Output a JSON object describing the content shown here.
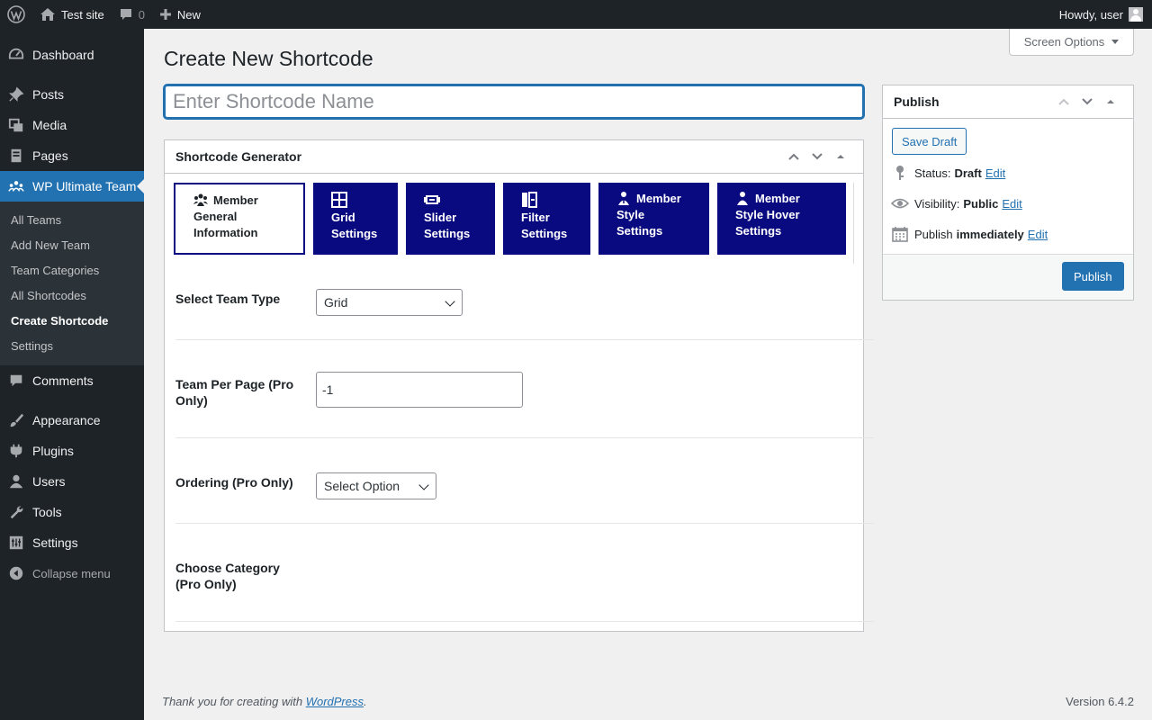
{
  "adminbar": {
    "site_name": "Test site",
    "comments_count": "0",
    "new_label": "New",
    "howdy": "Howdy, user"
  },
  "sidebar": {
    "items": [
      {
        "label": "Dashboard",
        "icon": "dashboard-icon"
      },
      {
        "label": "Posts",
        "icon": "pin-icon"
      },
      {
        "label": "Media",
        "icon": "media-icon"
      },
      {
        "label": "Pages",
        "icon": "pages-icon"
      },
      {
        "label": "WP Ultimate Team",
        "icon": "team-icon"
      },
      {
        "label": "Comments",
        "icon": "comment-icon"
      },
      {
        "label": "Appearance",
        "icon": "brush-icon"
      },
      {
        "label": "Plugins",
        "icon": "plugin-icon"
      },
      {
        "label": "Users",
        "icon": "user-icon"
      },
      {
        "label": "Tools",
        "icon": "wrench-icon"
      },
      {
        "label": "Settings",
        "icon": "settings-icon"
      }
    ],
    "submenu": [
      "All Teams",
      "Add New Team",
      "Team Categories",
      "All Shortcodes",
      "Create Shortcode",
      "Settings"
    ],
    "collapse_label": "Collapse menu"
  },
  "screen_options": "Screen Options",
  "page_title": "Create New Shortcode",
  "title_input": {
    "placeholder": "Enter Shortcode Name",
    "value": ""
  },
  "generator": {
    "title": "Shortcode Generator",
    "tabs": [
      {
        "l1": "Member",
        "l2": "General",
        "l3": "Information",
        "icon": "group-icon"
      },
      {
        "l1": "Grid",
        "l2": "Settings",
        "icon": "grid-icon"
      },
      {
        "l1": "Slider",
        "l2": "Settings",
        "icon": "slider-icon"
      },
      {
        "l1": "Filter",
        "l2": "Settings",
        "icon": "filter-icon"
      },
      {
        "l1": "Member",
        "l2": "Style",
        "l3": "Settings",
        "icon": "member-icon"
      },
      {
        "l1": "Member",
        "l2": "Style Hover",
        "l3": "Settings",
        "icon": "member-hover-icon"
      }
    ],
    "fields": {
      "team_type": {
        "label": "Select Team Type",
        "value": "Grid"
      },
      "per_page": {
        "label_1": "Team Per Page (Pro",
        "label_2": "Only)",
        "value": "-1"
      },
      "ordering": {
        "label": "Ordering (Pro Only)",
        "value": "Select Option"
      },
      "category": {
        "label_1": "Choose Category",
        "label_2": "(Pro Only)"
      }
    }
  },
  "publish": {
    "title": "Publish",
    "save_draft": "Save Draft",
    "status_label": "Status:",
    "status_value": "Draft",
    "visibility_label": "Visibility:",
    "visibility_value": "Public",
    "publish_label": "Publish",
    "publish_value": "immediately",
    "edit": "Edit",
    "publish_button": "Publish"
  },
  "footer": {
    "thanks_prefix": "Thank you for creating with ",
    "link": "WordPress",
    "suffix": ".",
    "version": "Version 6.4.2"
  }
}
